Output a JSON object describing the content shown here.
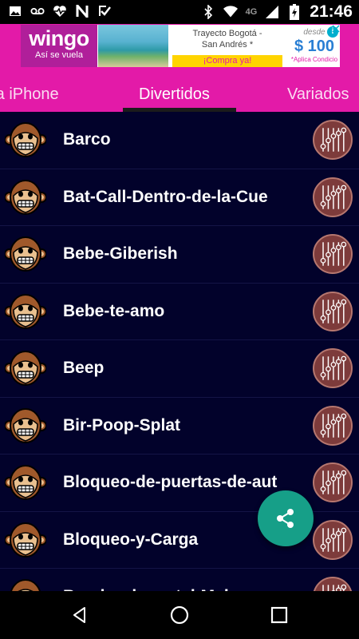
{
  "status_bar": {
    "time": "21:46",
    "network": "4G",
    "left_icons": [
      "image-icon",
      "voicemail-icon",
      "heart-pulse-icon",
      "n-logo-icon",
      "check-box-icon"
    ],
    "right_icons": [
      "bluetooth-icon",
      "wifi-icon",
      "signal-icon",
      "battery-charging-icon"
    ]
  },
  "ad": {
    "brand": "wingo",
    "slogan": "Así se vuela",
    "route_line1": "Trayecto Bogotá -",
    "route_line2": "San Andrés *",
    "cta": "¡Compra ya!",
    "price_prefix": "desde",
    "price": "$ 100",
    "conditions": "*Aplica Condicio",
    "choices_icon": "ad-choices-icon",
    "close_icon": "close-icon"
  },
  "tabs": [
    {
      "label": "ra iPhone",
      "active": false
    },
    {
      "label": "Divertidos",
      "active": true
    },
    {
      "label": "Variados",
      "active": false
    }
  ],
  "sounds": [
    {
      "name": "Barco"
    },
    {
      "name": "Bat-Call-Dentro-de-la-Cue"
    },
    {
      "name": "Bebe-Giberish"
    },
    {
      "name": "Bebe-te-amo"
    },
    {
      "name": "Beep"
    },
    {
      "name": "Bir-Poop-Splat"
    },
    {
      "name": "Bloqueo-de-puertas-de-aut"
    },
    {
      "name": "Bloqueo-y-Carga"
    },
    {
      "name": "Bombo-de-metal-Mala"
    }
  ],
  "fab": {
    "icon": "share-icon"
  },
  "nav_bar": {
    "buttons": [
      "back-icon",
      "home-icon",
      "recents-icon"
    ]
  },
  "colors": {
    "accent": "#e31aa8",
    "list_bg": "#02022b",
    "fab": "#169f88",
    "eq_button": "#7d3b3b",
    "monkey": "#a0592b"
  }
}
